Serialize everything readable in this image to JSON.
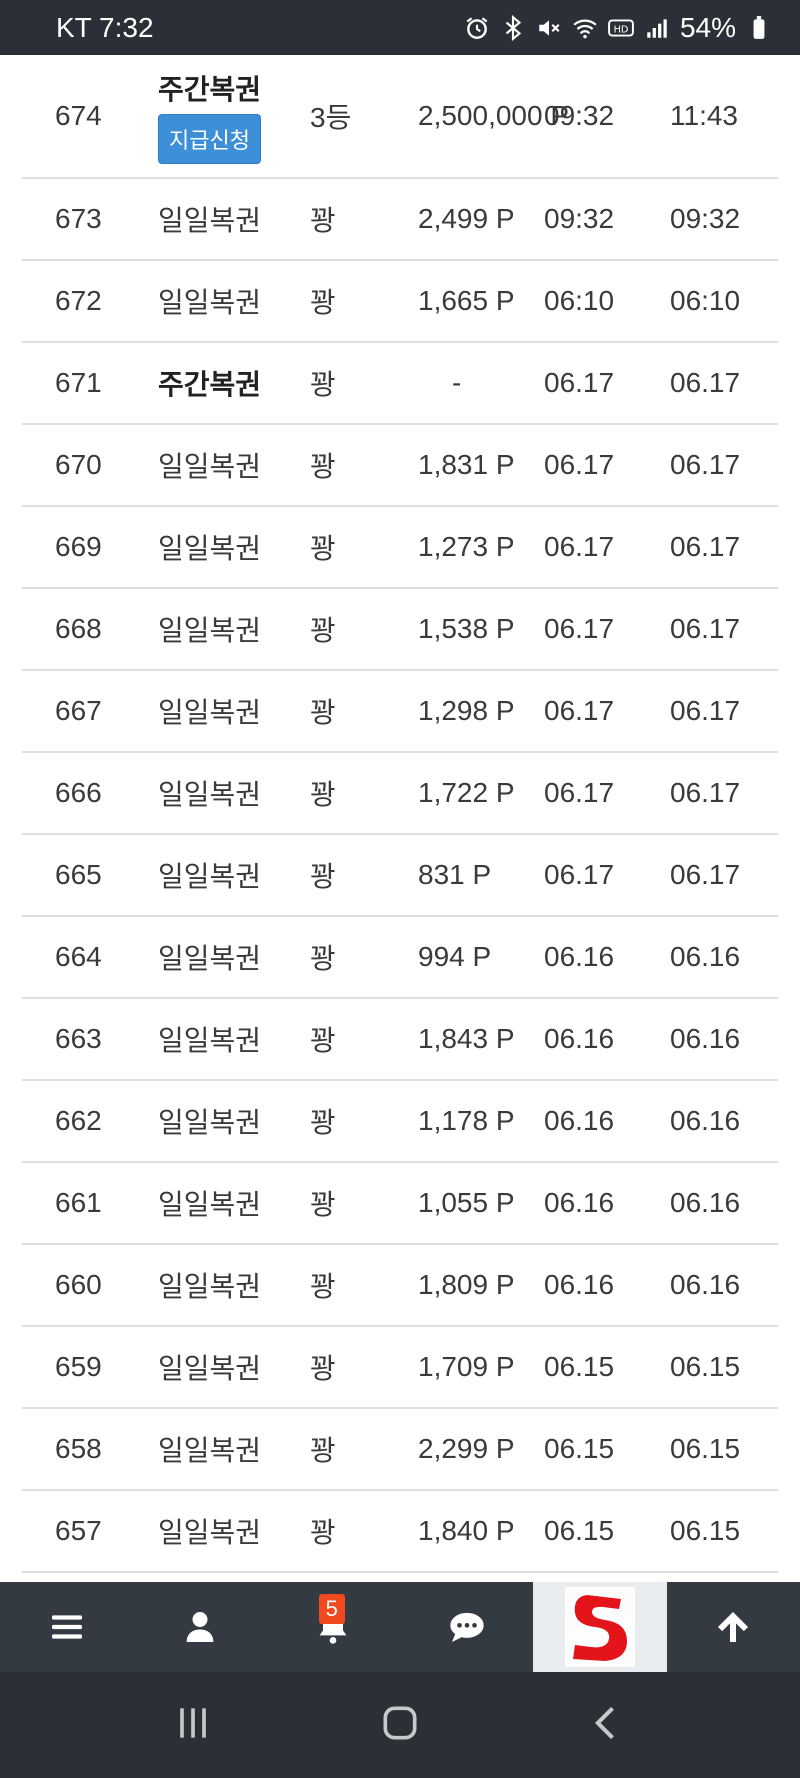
{
  "status_bar": {
    "carrier_time": "KT 7:32",
    "battery": "54%"
  },
  "table": {
    "rows": [
      {
        "no": "674",
        "type": "주간복권",
        "bold": true,
        "rank": "3등",
        "point": "2,500,000 P",
        "date1": "09:32",
        "date2": "11:43",
        "button": "지급신청"
      },
      {
        "no": "673",
        "type": "일일복권",
        "rank": "꽝",
        "point": "2,499 P",
        "date1": "09:32",
        "date2": "09:32"
      },
      {
        "no": "672",
        "type": "일일복권",
        "rank": "꽝",
        "point": "1,665 P",
        "date1": "06:10",
        "date2": "06:10"
      },
      {
        "no": "671",
        "type": "주간복권",
        "bold": true,
        "rank": "꽝",
        "point": "-",
        "date1": "06.17",
        "date2": "06.17"
      },
      {
        "no": "670",
        "type": "일일복권",
        "rank": "꽝",
        "point": "1,831 P",
        "date1": "06.17",
        "date2": "06.17"
      },
      {
        "no": "669",
        "type": "일일복권",
        "rank": "꽝",
        "point": "1,273 P",
        "date1": "06.17",
        "date2": "06.17"
      },
      {
        "no": "668",
        "type": "일일복권",
        "rank": "꽝",
        "point": "1,538 P",
        "date1": "06.17",
        "date2": "06.17"
      },
      {
        "no": "667",
        "type": "일일복권",
        "rank": "꽝",
        "point": "1,298 P",
        "date1": "06.17",
        "date2": "06.17"
      },
      {
        "no": "666",
        "type": "일일복권",
        "rank": "꽝",
        "point": "1,722 P",
        "date1": "06.17",
        "date2": "06.17"
      },
      {
        "no": "665",
        "type": "일일복권",
        "rank": "꽝",
        "point": "831 P",
        "date1": "06.17",
        "date2": "06.17"
      },
      {
        "no": "664",
        "type": "일일복권",
        "rank": "꽝",
        "point": "994 P",
        "date1": "06.16",
        "date2": "06.16"
      },
      {
        "no": "663",
        "type": "일일복권",
        "rank": "꽝",
        "point": "1,843 P",
        "date1": "06.16",
        "date2": "06.16"
      },
      {
        "no": "662",
        "type": "일일복권",
        "rank": "꽝",
        "point": "1,178 P",
        "date1": "06.16",
        "date2": "06.16"
      },
      {
        "no": "661",
        "type": "일일복권",
        "rank": "꽝",
        "point": "1,055 P",
        "date1": "06.16",
        "date2": "06.16"
      },
      {
        "no": "660",
        "type": "일일복권",
        "rank": "꽝",
        "point": "1,809 P",
        "date1": "06.16",
        "date2": "06.16"
      },
      {
        "no": "659",
        "type": "일일복권",
        "rank": "꽝",
        "point": "1,709 P",
        "date1": "06.15",
        "date2": "06.15"
      },
      {
        "no": "658",
        "type": "일일복권",
        "rank": "꽝",
        "point": "2,299 P",
        "date1": "06.15",
        "date2": "06.15"
      },
      {
        "no": "657",
        "type": "일일복권",
        "rank": "꽝",
        "point": "1,840 P",
        "date1": "06.15",
        "date2": "06.15"
      }
    ]
  },
  "app_bar": {
    "items": [
      "menu-icon",
      "user-icon",
      "bell-icon",
      "chat-icon",
      "site-logo",
      "arrow-up-icon"
    ],
    "notification_count": "5",
    "colors": {
      "bar": "#343a42",
      "badge": "#f04a1e",
      "logo_red": "#e3141a"
    }
  },
  "system_nav": {
    "items": [
      "recent-apps-icon",
      "home-icon",
      "back-icon"
    ]
  },
  "colors": {
    "accent_button": "#3d8fd8",
    "status_bar": "#2b2f36",
    "divider": "#dedede"
  }
}
